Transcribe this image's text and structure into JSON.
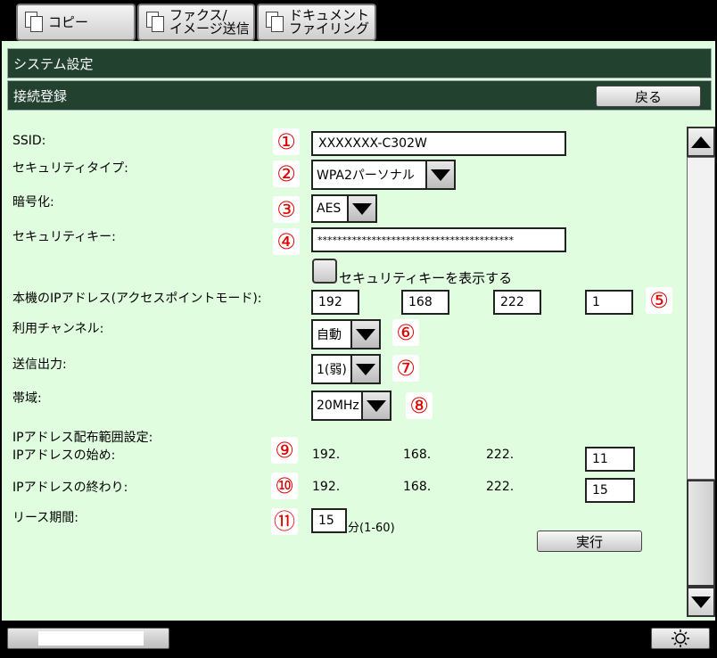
{
  "tabs": [
    {
      "label": "コピー"
    },
    {
      "label": "ファクス/\nイメージ送信"
    },
    {
      "label": "ドキュメント\nファイリング"
    }
  ],
  "header": {
    "title": "システム設定",
    "subtitle": "接続登録",
    "back_label": "戻る"
  },
  "form": {
    "ssid_label": "SSID:",
    "ssid_value": "XXXXXXX-C302W",
    "security_type_label": "セキュリティタイプ:",
    "security_type_value": "WPA2パーソナル",
    "encryption_label": "暗号化:",
    "encryption_value": "AES",
    "security_key_label": "セキュリティキー:",
    "security_key_value": "****************************************",
    "show_key_label": "セキュリティキーを表示する",
    "ip_label": "本機のIPアドレス(アクセスポイントモード):",
    "ip": [
      "192",
      "168",
      "222",
      "1"
    ],
    "channel_label": "利用チャンネル:",
    "channel_value": "自動",
    "power_label": "送信出力:",
    "power_value": "1(弱)",
    "band_label": "帯域:",
    "band_value": "20MHz",
    "range_label": "IPアドレス配布範囲設定:",
    "range_start_label": "IPアドレスの始め:",
    "range_end_label": "IPアドレスの終わり:",
    "range_prefix": [
      "192.",
      "168.",
      "222."
    ],
    "range_start_value": "11",
    "range_end_value": "15",
    "lease_label": "リース期間:",
    "lease_value": "15",
    "lease_unit": "分(1-60)",
    "execute_label": "実行"
  },
  "markers": [
    "①",
    "②",
    "③",
    "④",
    "⑤",
    "⑥",
    "⑦",
    "⑧",
    "⑨",
    "⑩",
    "⑪"
  ],
  "colors": {
    "accent_dark": "#22412f",
    "panel": "#e0fde0",
    "marker": "#e00000"
  },
  "icons": {
    "brightness": "sun-icon"
  }
}
